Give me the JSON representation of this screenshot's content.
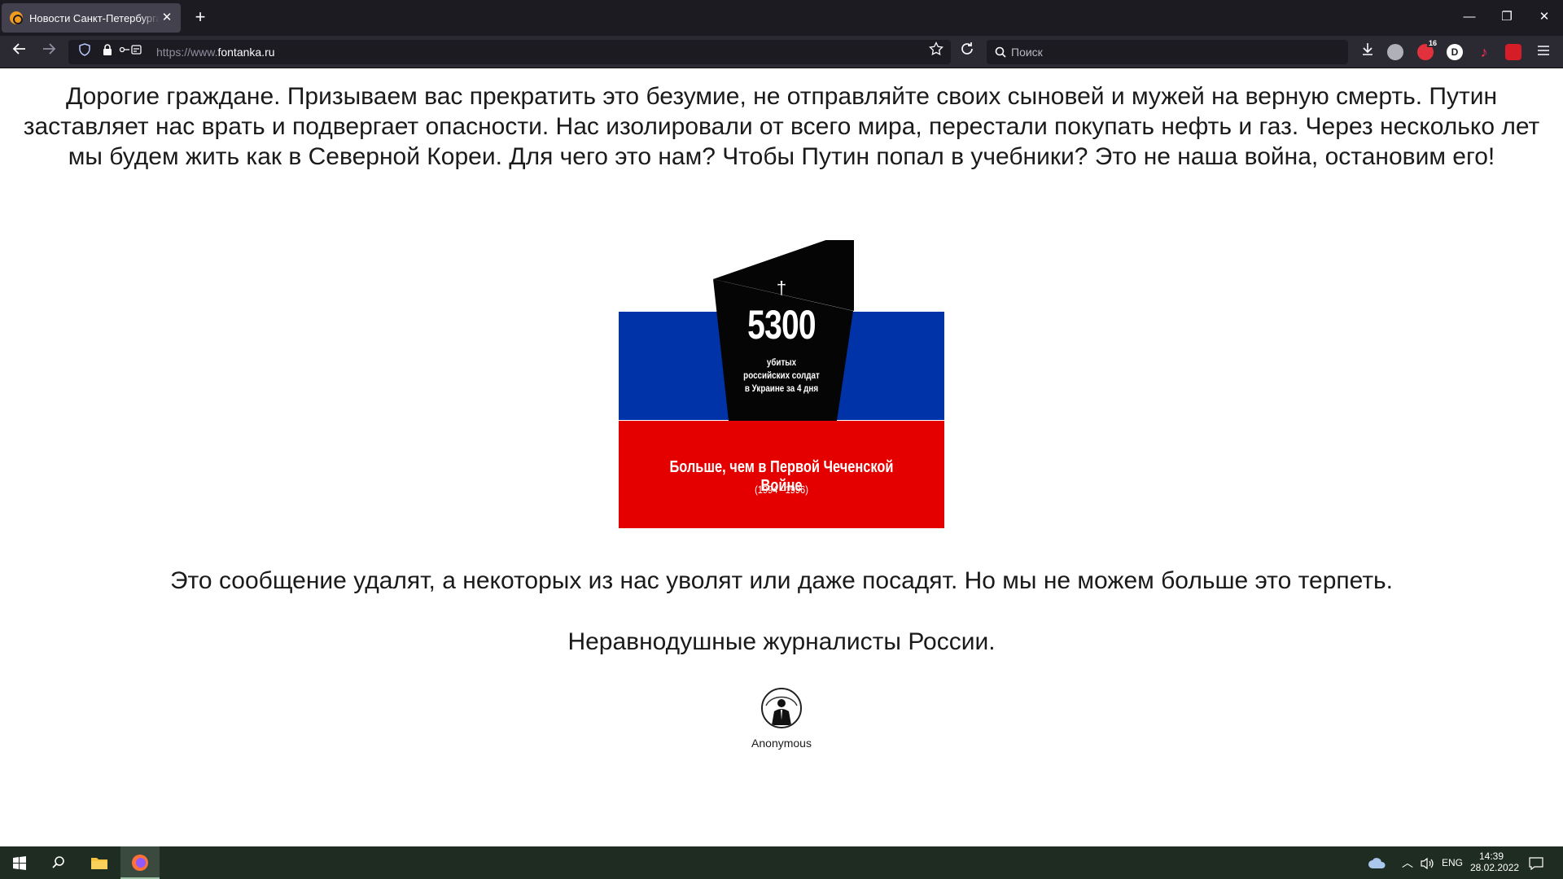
{
  "browser": {
    "tab_title": "Новости Санкт-Петербурга - ф",
    "tab_close": "✕",
    "new_tab": "+",
    "url_prefix": "https://www.",
    "url_host": "fontanka.ru",
    "search_placeholder": "Поиск",
    "extension_badge": "16",
    "extension_dl_letter": "D",
    "window_buttons": {
      "minimize": "—",
      "restore": "❐",
      "close": "✕"
    }
  },
  "page": {
    "paragraph_1_lines": [
      "Дорогие граждане. Призываем вас прекратить это безумие, не отправляйте своих сыновей и мужей на верную смерть. Путин",
      "заставляет нас врать и подвергает опасности. Нас изолировали от всего мира, перестали покупать нефть и газ. Через несколько лет",
      "мы будем жить как в Северной Кореи. Для чего это нам? Чтобы Путин попал в учебники? Это не наша война, остановим его!"
    ],
    "banner": {
      "cross": "†",
      "number": "5300",
      "subtitle_lines": [
        "убитых",
        "российских солдат",
        "в Украине за 4 дня"
      ],
      "red_title": "Больше, чем в Первой Чеченской Войне",
      "red_years": "(1994 –1996)"
    },
    "paragraph_2": "Это сообщение удалят, а некоторых из нас уволят или даже посадят. Но мы не можем больше это терпеть.",
    "paragraph_3": "Неравнодушные журналисты России.",
    "anonymous_caption": "Anonymous"
  },
  "taskbar": {
    "language": "ENG",
    "time": "14:39",
    "date": "28.02.2022"
  },
  "colors": {
    "flag_blue": "#0033a8",
    "flag_red": "#e50000",
    "stone": "#050505"
  }
}
